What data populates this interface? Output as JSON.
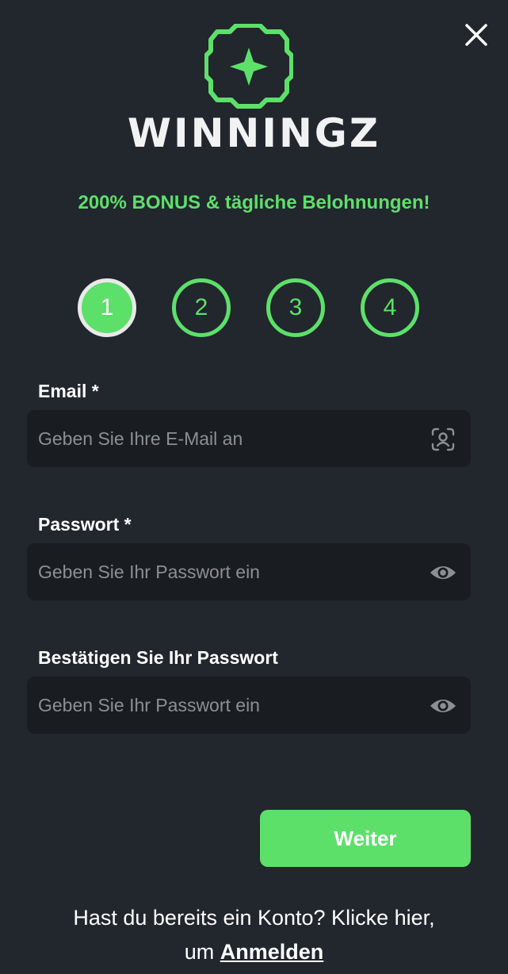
{
  "header": {
    "brand_name": "WINNINGZ",
    "logo_icon": "clover-star-icon",
    "close_icon": "close-icon",
    "tagline": "200% BONUS & tägliche Belohnungen!"
  },
  "steps": {
    "items": [
      "1",
      "2",
      "3",
      "4"
    ],
    "current": 1
  },
  "form": {
    "email": {
      "label": "Email *",
      "placeholder": "Geben Sie Ihre E-Mail an",
      "value": "",
      "icon": "user-scan-icon"
    },
    "password": {
      "label": "Passwort *",
      "placeholder": "Geben Sie Ihr Passwort ein",
      "value": "",
      "icon": "eye-icon"
    },
    "confirm_password": {
      "label": "Bestätigen Sie Ihr Passwort",
      "placeholder": "Geben Sie Ihr Passwort ein",
      "value": "",
      "icon": "eye-icon"
    },
    "submit_label": "Weiter"
  },
  "footer": {
    "text_line1": "Hast du bereits ein Konto? Klicke hier,",
    "text_line2": "um",
    "login_link": "Anmelden"
  },
  "colors": {
    "background": "#22262d",
    "field_background": "#191c21",
    "accent": "#5ce06a",
    "text": "#ffffff",
    "placeholder": "#8c8f94"
  }
}
